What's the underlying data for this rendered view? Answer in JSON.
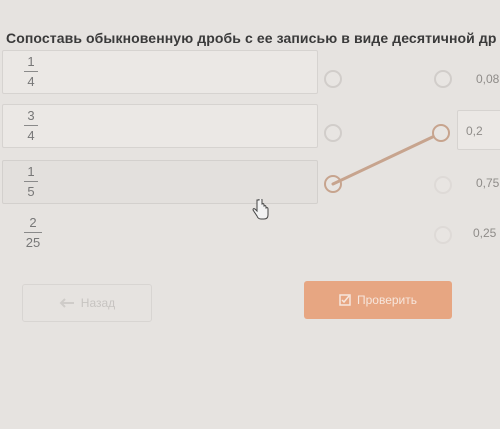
{
  "question": {
    "title": "Сопоставь обыкновенную дробь с ее записью в виде десятичной др"
  },
  "left_items": [
    {
      "numerator": "1",
      "denominator": "4"
    },
    {
      "numerator": "3",
      "denominator": "4"
    },
    {
      "numerator": "1",
      "denominator": "5"
    },
    {
      "numerator": "2",
      "denominator": "25"
    }
  ],
  "right_items": [
    {
      "value": "0,08"
    },
    {
      "value": "0,2"
    },
    {
      "value": "0,75"
    },
    {
      "value": "0,25"
    }
  ],
  "connection": {
    "from_left": "1/5",
    "to_right": "0,2"
  },
  "buttons": {
    "back_label": "Назад",
    "back_icon": "arrow-left-icon",
    "check_label": "Проверить",
    "check_icon": "check-square-icon"
  },
  "colors": {
    "accent": "#e7a682",
    "connector": "#c7a48e"
  }
}
